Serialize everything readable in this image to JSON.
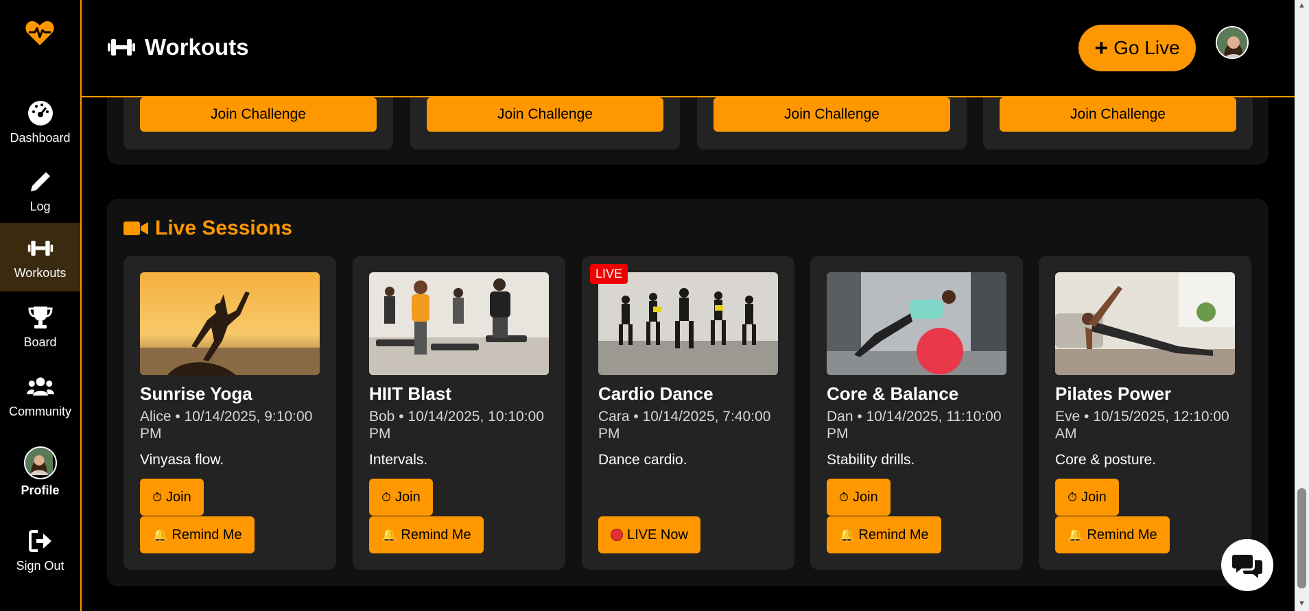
{
  "sidebar": {
    "logo_icon": "heartbeat-icon",
    "items": [
      {
        "label": "Dashboard",
        "icon": "gauge-icon"
      },
      {
        "label": "Log",
        "icon": "pencil-icon"
      },
      {
        "label": "Workouts",
        "icon": "dumbbell-icon",
        "active": true
      },
      {
        "label": "Board",
        "icon": "trophy-icon"
      },
      {
        "label": "Community",
        "icon": "users-icon"
      },
      {
        "label": "Profile",
        "icon": "avatar"
      },
      {
        "label": "Sign Out",
        "icon": "sign-out-icon"
      }
    ]
  },
  "header": {
    "title": "Workouts",
    "go_live_label": "Go Live"
  },
  "challenges": {
    "buttons": [
      "Join Challenge",
      "Join Challenge",
      "Join Challenge",
      "Join Challenge"
    ]
  },
  "live": {
    "heading": "Live Sessions",
    "sessions": [
      {
        "title": "Sunrise Yoga",
        "meta": "Alice • 10/14/2025, 9:10:00 PM",
        "desc": "Vinyasa flow.",
        "join": "Join",
        "remind": "Remind Me",
        "is_live": false
      },
      {
        "title": "HIIT Blast",
        "meta": "Bob • 10/14/2025, 10:10:00 PM",
        "desc": "Intervals.",
        "join": "Join",
        "remind": "Remind Me",
        "is_live": false
      },
      {
        "title": "Cardio Dance",
        "meta": "Cara • 10/14/2025, 7:40:00 PM",
        "desc": "Dance cardio.",
        "live_badge": "LIVE",
        "live_now": "LIVE Now",
        "is_live": true
      },
      {
        "title": "Core & Balance",
        "meta": "Dan • 10/14/2025, 11:10:00 PM",
        "desc": "Stability drills.",
        "join": "Join",
        "remind": "Remind Me",
        "is_live": false
      },
      {
        "title": "Pilates Power",
        "meta": "Eve • 10/15/2025, 12:10:00 AM",
        "desc": "Core & posture.",
        "join": "Join",
        "remind": "Remind Me",
        "is_live": false
      }
    ]
  },
  "colors": {
    "accent": "#ff9800",
    "live": "#ee0000",
    "card": "#232323",
    "panel": "#111111"
  }
}
